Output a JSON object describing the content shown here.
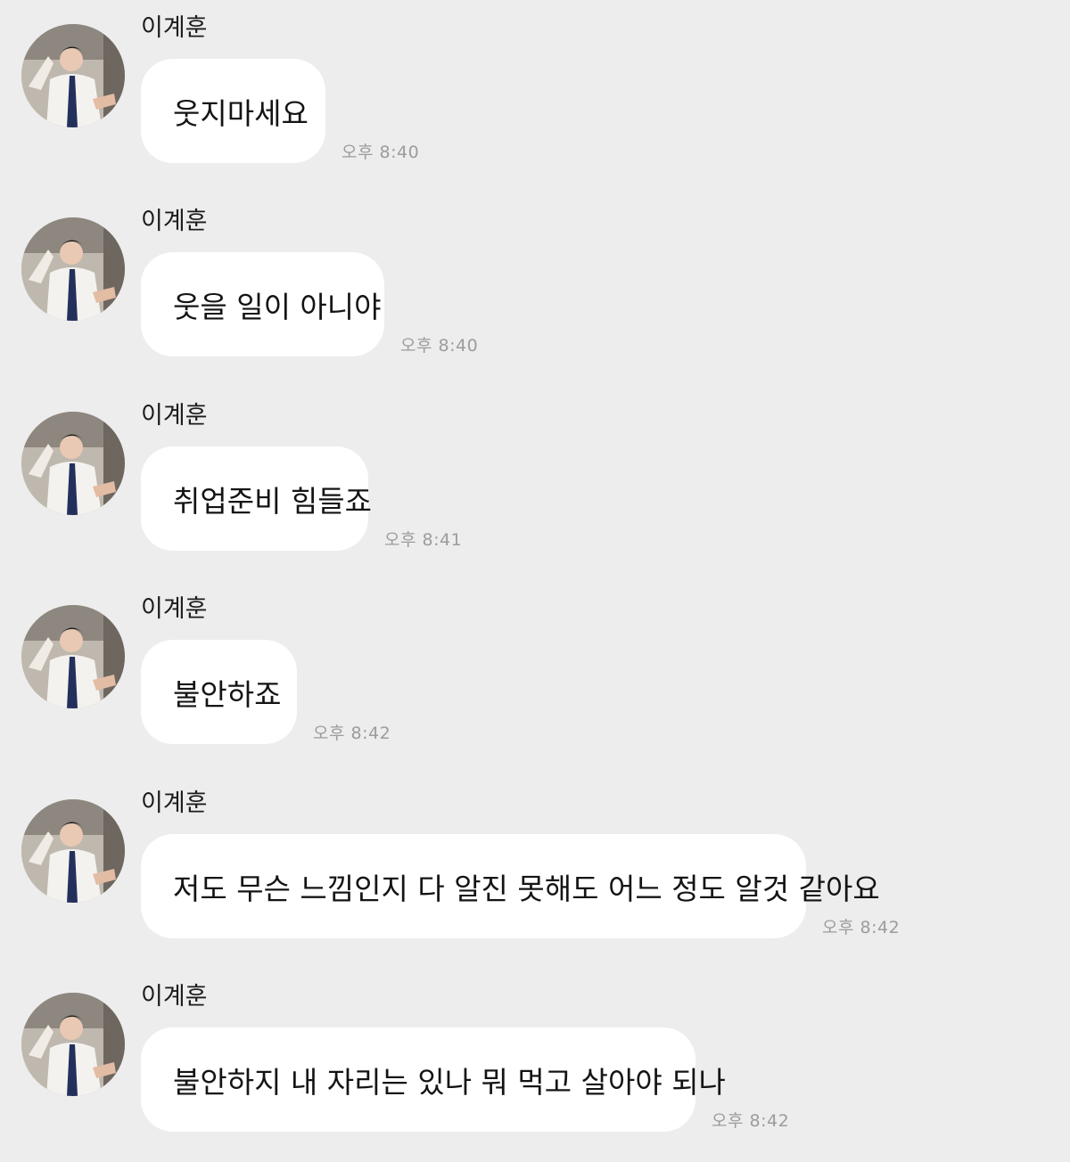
{
  "messages": [
    {
      "sender": "이계훈",
      "text": "웃지마세요",
      "time": "오후 8:40"
    },
    {
      "sender": "이계훈",
      "text": "웃을 일이 아니야",
      "time": "오후 8:40"
    },
    {
      "sender": "이계훈",
      "text": "취업준비 힘들죠",
      "time": "오후 8:41"
    },
    {
      "sender": "이계훈",
      "text": "불안하죠",
      "time": "오후 8:42"
    },
    {
      "sender": "이계훈",
      "text": "저도 무슨 느낌인지 다 알진 못해도 어느 정도 알것 같아요",
      "time": "오후 8:42"
    },
    {
      "sender": "이계훈",
      "text": "불안하지 내 자리는 있나 뭐 먹고 살아야 되나",
      "time": "오후 8:42"
    }
  ],
  "colors": {
    "background": "#ededed",
    "bubble": "#ffffff",
    "timestamp": "#9c9c9c"
  },
  "icons": {
    "avatar": "profile-photo"
  }
}
